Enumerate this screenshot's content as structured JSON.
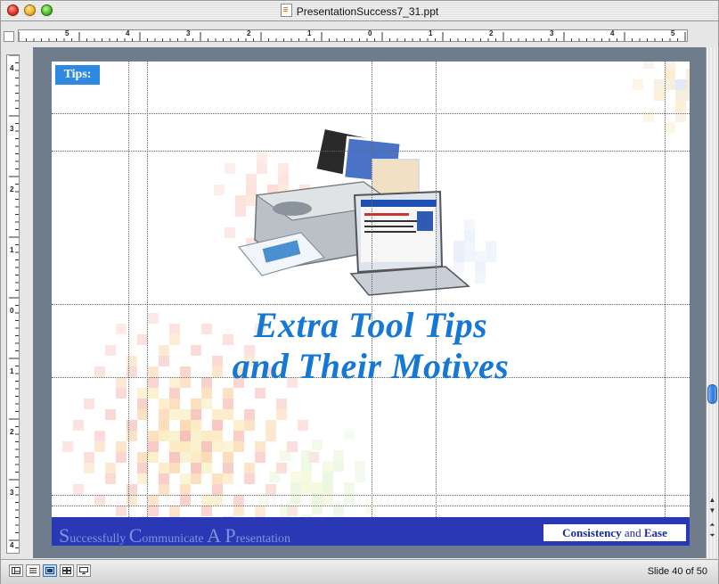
{
  "window": {
    "title": "PresentationSuccess7_31.ppt"
  },
  "rulers": {
    "horizontal_labels": [
      "5",
      "4",
      "3",
      "2",
      "1",
      "0",
      "1",
      "2",
      "3",
      "4",
      "5"
    ],
    "vertical_labels": [
      "4",
      "3",
      "2",
      "1",
      "0",
      "1",
      "2",
      "3",
      "4"
    ]
  },
  "slide": {
    "tips_label": "Tips:",
    "title_line1": "Extra Tool Tips",
    "title_line2": "and Their Motives",
    "footer_left": {
      "s": "S",
      "uccessfully": "uccessfully ",
      "c": "C",
      "ommunicate": "ommunicate ",
      "a": "A ",
      "p": "P",
      "resentation": "resentation"
    },
    "footer_right_bold": "Consistency",
    "footer_right_mid": " and ",
    "footer_right_end": "Ease",
    "colors": {
      "title": "#1478d4",
      "footer_bar": "#2b38b5",
      "tips_box": "#2d8ae0"
    }
  },
  "status": {
    "slide_indicator": "Slide 40 of 50"
  },
  "view_buttons": [
    "normal-view-icon",
    "outline-view-icon",
    "slide-view-icon",
    "slide-sorter-view-icon",
    "slide-show-icon"
  ]
}
